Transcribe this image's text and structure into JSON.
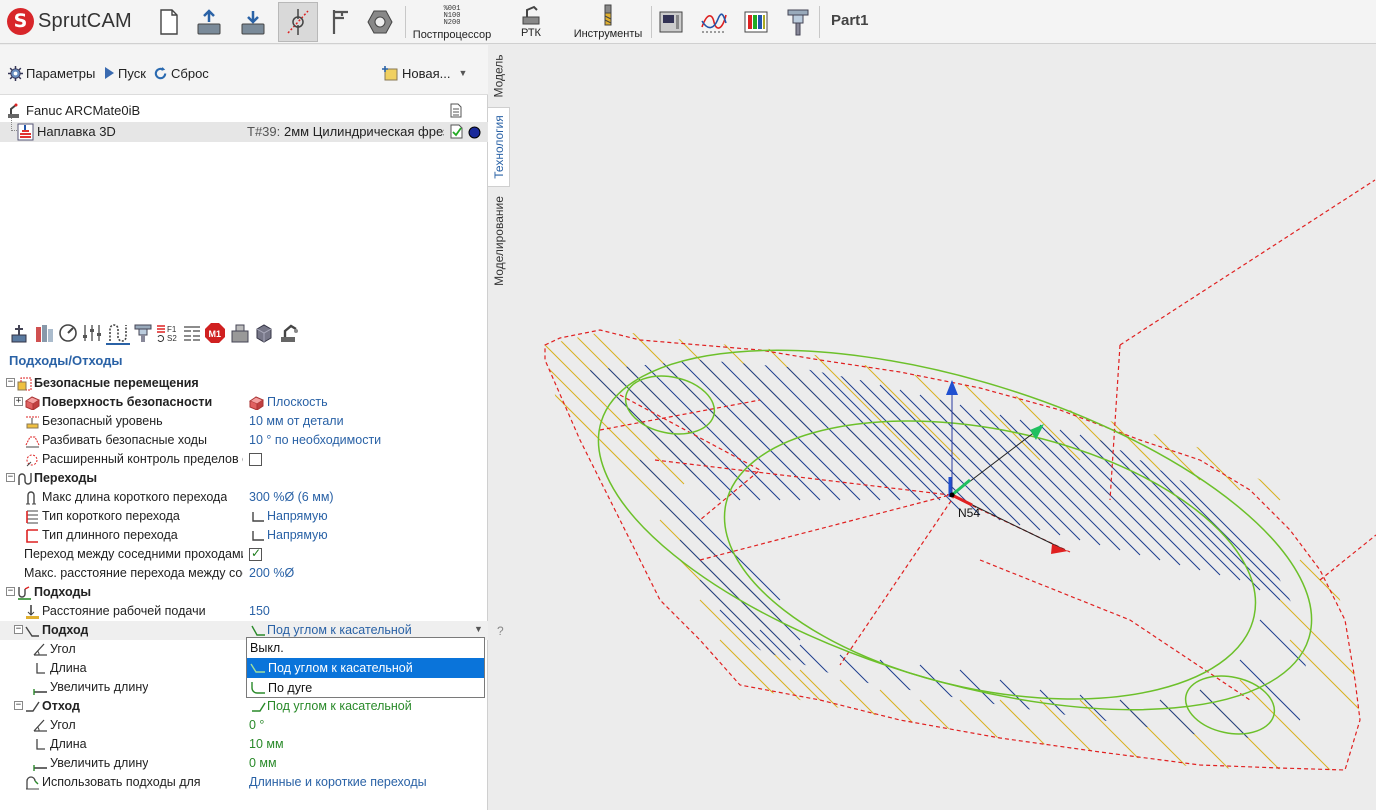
{
  "app": {
    "name": "SprutCAM",
    "logo_letter": "S",
    "part_title": "Part1"
  },
  "toolbar": {
    "postprocessor_label": "Постпроцессор",
    "postprocessor_glyph": [
      "%001",
      "N100",
      "N200"
    ],
    "rtk_label": "РТК",
    "tools_label": "Инструменты"
  },
  "commands": {
    "params": "Параметры",
    "run": "Пуск",
    "reset": "Сброс",
    "new": "Новая..."
  },
  "tree": {
    "machine": "Fanuc ARCMate0iB",
    "operation": "Наплавка 3D",
    "tool_code": "T#39:",
    "tool_name": "2мм Цилиндрическая фрез"
  },
  "vertical_tabs": [
    "Модель",
    "Технология",
    "Моделирование"
  ],
  "param_icons": {
    "badge": "M1"
  },
  "section_title": "Подходы/Отходы",
  "params": {
    "safe_moves": "Безопасные перемещения",
    "safe_surface": "Поверхность безопасности",
    "safe_surface_val": "Плоскость",
    "safe_level": "Безопасный уровень",
    "safe_level_val": "10 мм от детали",
    "split_safe": "Разбивать безопасные ходы",
    "split_safe_val": "10 ° по необходимости",
    "ext_control": "Расширенный контроль пределов с",
    "transitions": "Переходы",
    "max_short": "Макс длина короткого перехода",
    "max_short_val": "300 %Ø (6 мм)",
    "short_type": "Тип короткого перехода",
    "short_type_val": "Напрямую",
    "long_type": "Тип длинного перехода",
    "long_type_val": "Напрямую",
    "adjacent": "Переход между соседними проходами",
    "max_dist": "Макс. расстояние перехода между сос",
    "max_dist_val": "200 %Ø",
    "approaches": "Подходы",
    "feed_dist": "Расстояние рабочей подачи",
    "feed_dist_val": "150",
    "approach": "Подход",
    "approach_val": "Под углом к касательной",
    "angle": "Угол",
    "length": "Длина",
    "increase_length": "Увеличить длину",
    "retract": "Отход",
    "retract_val": "Под углом к касательной",
    "r_angle": "Угол",
    "r_angle_val": "0 °",
    "r_length": "Длина",
    "r_length_val": "10 мм",
    "r_increase": "Увеличить длину",
    "r_increase_val": "0 мм",
    "use_for": "Использовать подходы для",
    "use_for_val": "Длинные и короткие переходы"
  },
  "dropdown": {
    "options": [
      "Выкл.",
      "Под углом к касательной",
      "По дуге"
    ],
    "selected_index": 1
  },
  "help_mark": "?",
  "viewport": {
    "label": "N54"
  },
  "colors": {
    "accent_blue": "#2a62a6",
    "selection_blue": "#0a74da",
    "green_value": "#2a8a2a",
    "path_red": "#e02020",
    "path_orange": "#d4a017",
    "path_blue": "#1f3f8f",
    "contour_green": "#6cc02a"
  }
}
